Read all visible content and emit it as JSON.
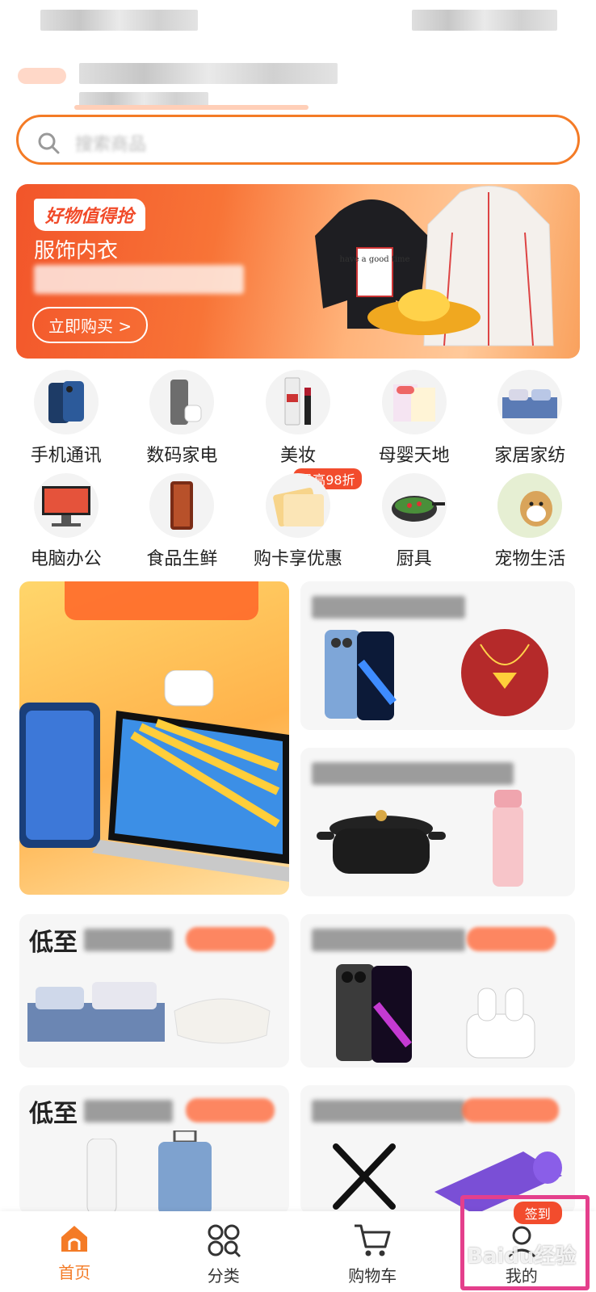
{
  "search": {
    "placeholder": "搜索商品"
  },
  "banner": {
    "tag": "好物值得抢",
    "title": "服饰内衣",
    "button": "立即购买 >",
    "shirt_text": "have a good time"
  },
  "categories": [
    {
      "label": "手机通讯",
      "icon": "phone-icon"
    },
    {
      "label": "数码家电",
      "icon": "appliance-icon"
    },
    {
      "label": "美妆",
      "icon": "cosmetics-icon"
    },
    {
      "label": "母婴天地",
      "icon": "baby-icon"
    },
    {
      "label": "家居家纺",
      "icon": "bedding-icon"
    },
    {
      "label": "电脑办公",
      "icon": "computer-icon"
    },
    {
      "label": "食品生鲜",
      "icon": "food-icon"
    },
    {
      "label": "购卡享优惠",
      "icon": "card-icon",
      "badge": "最高98折"
    },
    {
      "label": "厨具",
      "icon": "wok-icon"
    },
    {
      "label": "宠物生活",
      "icon": "pet-icon"
    }
  ],
  "cards": {
    "bottom_left_1_title": "低至",
    "bottom_left_2_title": "低至"
  },
  "bottom_nav": [
    {
      "label": "首页",
      "icon": "home-icon",
      "active": true
    },
    {
      "label": "分类",
      "icon": "category-icon",
      "active": false
    },
    {
      "label": "购物车",
      "icon": "cart-icon",
      "active": false
    },
    {
      "label": "我的",
      "icon": "profile-icon",
      "active": false,
      "badge": "签到"
    }
  ],
  "watermark": "Baidu经验",
  "colors": {
    "accent": "#f47b26",
    "badge": "#f24c2d",
    "highlight": "#e43f8c"
  }
}
